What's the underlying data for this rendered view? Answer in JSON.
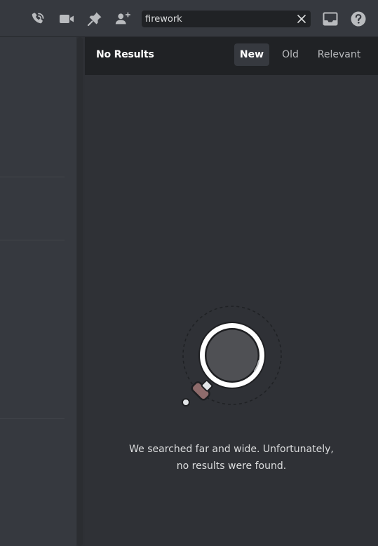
{
  "toolbar": {
    "icons": [
      "threads-phone-icon",
      "video-call-icon",
      "pin-icon",
      "add-member-icon",
      "inbox-icon",
      "help-icon"
    ]
  },
  "search": {
    "value": "firework",
    "clear_icon": "close-icon"
  },
  "results": {
    "title": "No Results",
    "tabs": [
      {
        "label": "New",
        "active": true
      },
      {
        "label": "Old",
        "active": false
      },
      {
        "label": "Relevant",
        "active": false
      }
    ],
    "empty_line1": "We searched far and wide. Unfortunately,",
    "empty_line2": "no results were found.",
    "illustration_icon": "magnifying-glass-icon"
  },
  "colors": {
    "background": "#36393f",
    "panel": "#2f3136",
    "header": "#202225",
    "text_muted": "#b9bbbe",
    "text_normal": "#dcddde",
    "text_bright": "#ffffff"
  }
}
